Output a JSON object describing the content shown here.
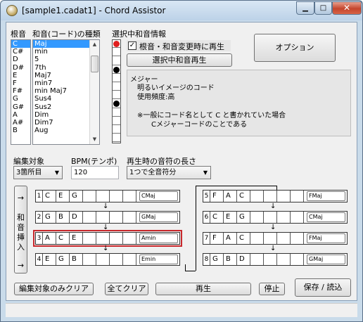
{
  "window": {
    "title": "[sample1.cadat1] - Chord Assistor"
  },
  "root": {
    "header": "根音",
    "items": [
      "C",
      "C#",
      "D",
      "D#",
      "E",
      "F",
      "F#",
      "G",
      "G#",
      "A",
      "A#",
      "B"
    ],
    "selected_index": 0
  },
  "chord_type": {
    "header": "和音(コード)の種類",
    "items": [
      "Maj",
      "min",
      "5",
      "7th",
      "Maj7",
      "min7",
      "min Maj7",
      "Sus4",
      "Sus2",
      "Dim",
      "Dim7",
      "Aug"
    ],
    "selected_index": 0
  },
  "selected_chord_info": {
    "header": "選択中和音情報",
    "checkbox_label": "根音・和音変更時に再生",
    "checkbox_checked": true,
    "play_button": "選択中和音再生",
    "dots": [
      "red",
      "empty",
      "empty",
      "black",
      "empty",
      "empty",
      "empty",
      "black",
      "empty",
      "empty",
      "empty",
      "empty"
    ],
    "description_lines": [
      "メジャー",
      "明るいイメージのコード",
      "使用頻度:高",
      "",
      "※一般にコード名として C と書かれていた場合",
      "Cメジャーコードのことである"
    ]
  },
  "options_button": "オプション",
  "edit_target": {
    "label": "編集対象",
    "value": "3箇所目"
  },
  "bpm": {
    "label": "BPM(テンポ)",
    "value": "120"
  },
  "note_length": {
    "label": "再生時の音符の長さ",
    "value": "1つで全音符分"
  },
  "insert_button": {
    "top_arrow": "→",
    "text": [
      "和",
      "音",
      "挿",
      "入"
    ],
    "bottom_arrow": "→"
  },
  "sequence": [
    {
      "index": "1",
      "notes": [
        "C",
        "E",
        "G",
        "",
        "",
        "",
        ""
      ],
      "name": "CMaj"
    },
    {
      "index": "2",
      "notes": [
        "G",
        "B",
        "D",
        "",
        "",
        "",
        ""
      ],
      "name": "GMaj"
    },
    {
      "index": "3",
      "notes": [
        "A",
        "C",
        "E",
        "",
        "",
        "",
        ""
      ],
      "name": "Amin",
      "selected": true
    },
    {
      "index": "4",
      "notes": [
        "E",
        "G",
        "B",
        "",
        "",
        "",
        ""
      ],
      "name": "Emin"
    },
    {
      "index": "5",
      "notes": [
        "F",
        "A",
        "C",
        "",
        "",
        "",
        ""
      ],
      "name": "FMaj"
    },
    {
      "index": "6",
      "notes": [
        "C",
        "E",
        "G",
        "",
        "",
        "",
        ""
      ],
      "name": "CMaj"
    },
    {
      "index": "7",
      "notes": [
        "F",
        "A",
        "C",
        "",
        "",
        "",
        ""
      ],
      "name": "FMaj"
    },
    {
      "index": "8",
      "notes": [
        "G",
        "B",
        "D",
        "",
        "",
        "",
        ""
      ],
      "name": "GMaj"
    }
  ],
  "flow_arrow": "↓",
  "bottom_buttons": {
    "clear_target": "編集対象のみクリア",
    "clear_all": "全てクリア",
    "play": "再生",
    "stop": "停止",
    "save_load": "保存 / 読込"
  },
  "colors": {
    "selected_row_border": "#c8282c",
    "list_selection": "#3399ff",
    "dot_red": "#e02020",
    "dot_black": "#000000"
  }
}
